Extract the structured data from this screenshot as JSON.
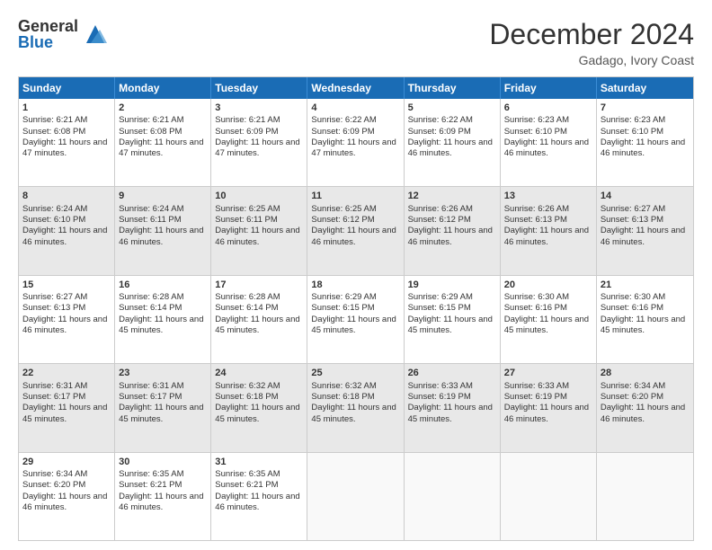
{
  "logo": {
    "general": "General",
    "blue": "Blue"
  },
  "title": "December 2024",
  "location": "Gadago, Ivory Coast",
  "days": [
    "Sunday",
    "Monday",
    "Tuesday",
    "Wednesday",
    "Thursday",
    "Friday",
    "Saturday"
  ],
  "weeks": [
    [
      {
        "day": "1",
        "sunrise": "6:21 AM",
        "sunset": "6:08 PM",
        "daylight": "11 hours and 47 minutes."
      },
      {
        "day": "2",
        "sunrise": "6:21 AM",
        "sunset": "6:08 PM",
        "daylight": "11 hours and 47 minutes."
      },
      {
        "day": "3",
        "sunrise": "6:21 AM",
        "sunset": "6:09 PM",
        "daylight": "11 hours and 47 minutes."
      },
      {
        "day": "4",
        "sunrise": "6:22 AM",
        "sunset": "6:09 PM",
        "daylight": "11 hours and 47 minutes."
      },
      {
        "day": "5",
        "sunrise": "6:22 AM",
        "sunset": "6:09 PM",
        "daylight": "11 hours and 46 minutes."
      },
      {
        "day": "6",
        "sunrise": "6:23 AM",
        "sunset": "6:10 PM",
        "daylight": "11 hours and 46 minutes."
      },
      {
        "day": "7",
        "sunrise": "6:23 AM",
        "sunset": "6:10 PM",
        "daylight": "11 hours and 46 minutes."
      }
    ],
    [
      {
        "day": "8",
        "sunrise": "6:24 AM",
        "sunset": "6:10 PM",
        "daylight": "11 hours and 46 minutes."
      },
      {
        "day": "9",
        "sunrise": "6:24 AM",
        "sunset": "6:11 PM",
        "daylight": "11 hours and 46 minutes."
      },
      {
        "day": "10",
        "sunrise": "6:25 AM",
        "sunset": "6:11 PM",
        "daylight": "11 hours and 46 minutes."
      },
      {
        "day": "11",
        "sunrise": "6:25 AM",
        "sunset": "6:12 PM",
        "daylight": "11 hours and 46 minutes."
      },
      {
        "day": "12",
        "sunrise": "6:26 AM",
        "sunset": "6:12 PM",
        "daylight": "11 hours and 46 minutes."
      },
      {
        "day": "13",
        "sunrise": "6:26 AM",
        "sunset": "6:13 PM",
        "daylight": "11 hours and 46 minutes."
      },
      {
        "day": "14",
        "sunrise": "6:27 AM",
        "sunset": "6:13 PM",
        "daylight": "11 hours and 46 minutes."
      }
    ],
    [
      {
        "day": "15",
        "sunrise": "6:27 AM",
        "sunset": "6:13 PM",
        "daylight": "11 hours and 46 minutes."
      },
      {
        "day": "16",
        "sunrise": "6:28 AM",
        "sunset": "6:14 PM",
        "daylight": "11 hours and 45 minutes."
      },
      {
        "day": "17",
        "sunrise": "6:28 AM",
        "sunset": "6:14 PM",
        "daylight": "11 hours and 45 minutes."
      },
      {
        "day": "18",
        "sunrise": "6:29 AM",
        "sunset": "6:15 PM",
        "daylight": "11 hours and 45 minutes."
      },
      {
        "day": "19",
        "sunrise": "6:29 AM",
        "sunset": "6:15 PM",
        "daylight": "11 hours and 45 minutes."
      },
      {
        "day": "20",
        "sunrise": "6:30 AM",
        "sunset": "6:16 PM",
        "daylight": "11 hours and 45 minutes."
      },
      {
        "day": "21",
        "sunrise": "6:30 AM",
        "sunset": "6:16 PM",
        "daylight": "11 hours and 45 minutes."
      }
    ],
    [
      {
        "day": "22",
        "sunrise": "6:31 AM",
        "sunset": "6:17 PM",
        "daylight": "11 hours and 45 minutes."
      },
      {
        "day": "23",
        "sunrise": "6:31 AM",
        "sunset": "6:17 PM",
        "daylight": "11 hours and 45 minutes."
      },
      {
        "day": "24",
        "sunrise": "6:32 AM",
        "sunset": "6:18 PM",
        "daylight": "11 hours and 45 minutes."
      },
      {
        "day": "25",
        "sunrise": "6:32 AM",
        "sunset": "6:18 PM",
        "daylight": "11 hours and 45 minutes."
      },
      {
        "day": "26",
        "sunrise": "6:33 AM",
        "sunset": "6:19 PM",
        "daylight": "11 hours and 45 minutes."
      },
      {
        "day": "27",
        "sunrise": "6:33 AM",
        "sunset": "6:19 PM",
        "daylight": "11 hours and 46 minutes."
      },
      {
        "day": "28",
        "sunrise": "6:34 AM",
        "sunset": "6:20 PM",
        "daylight": "11 hours and 46 minutes."
      }
    ],
    [
      {
        "day": "29",
        "sunrise": "6:34 AM",
        "sunset": "6:20 PM",
        "daylight": "11 hours and 46 minutes."
      },
      {
        "day": "30",
        "sunrise": "6:35 AM",
        "sunset": "6:21 PM",
        "daylight": "11 hours and 46 minutes."
      },
      {
        "day": "31",
        "sunrise": "6:35 AM",
        "sunset": "6:21 PM",
        "daylight": "11 hours and 46 minutes."
      },
      null,
      null,
      null,
      null
    ]
  ],
  "labels": {
    "sunrise": "Sunrise: ",
    "sunset": "Sunset: ",
    "daylight": "Daylight: "
  }
}
